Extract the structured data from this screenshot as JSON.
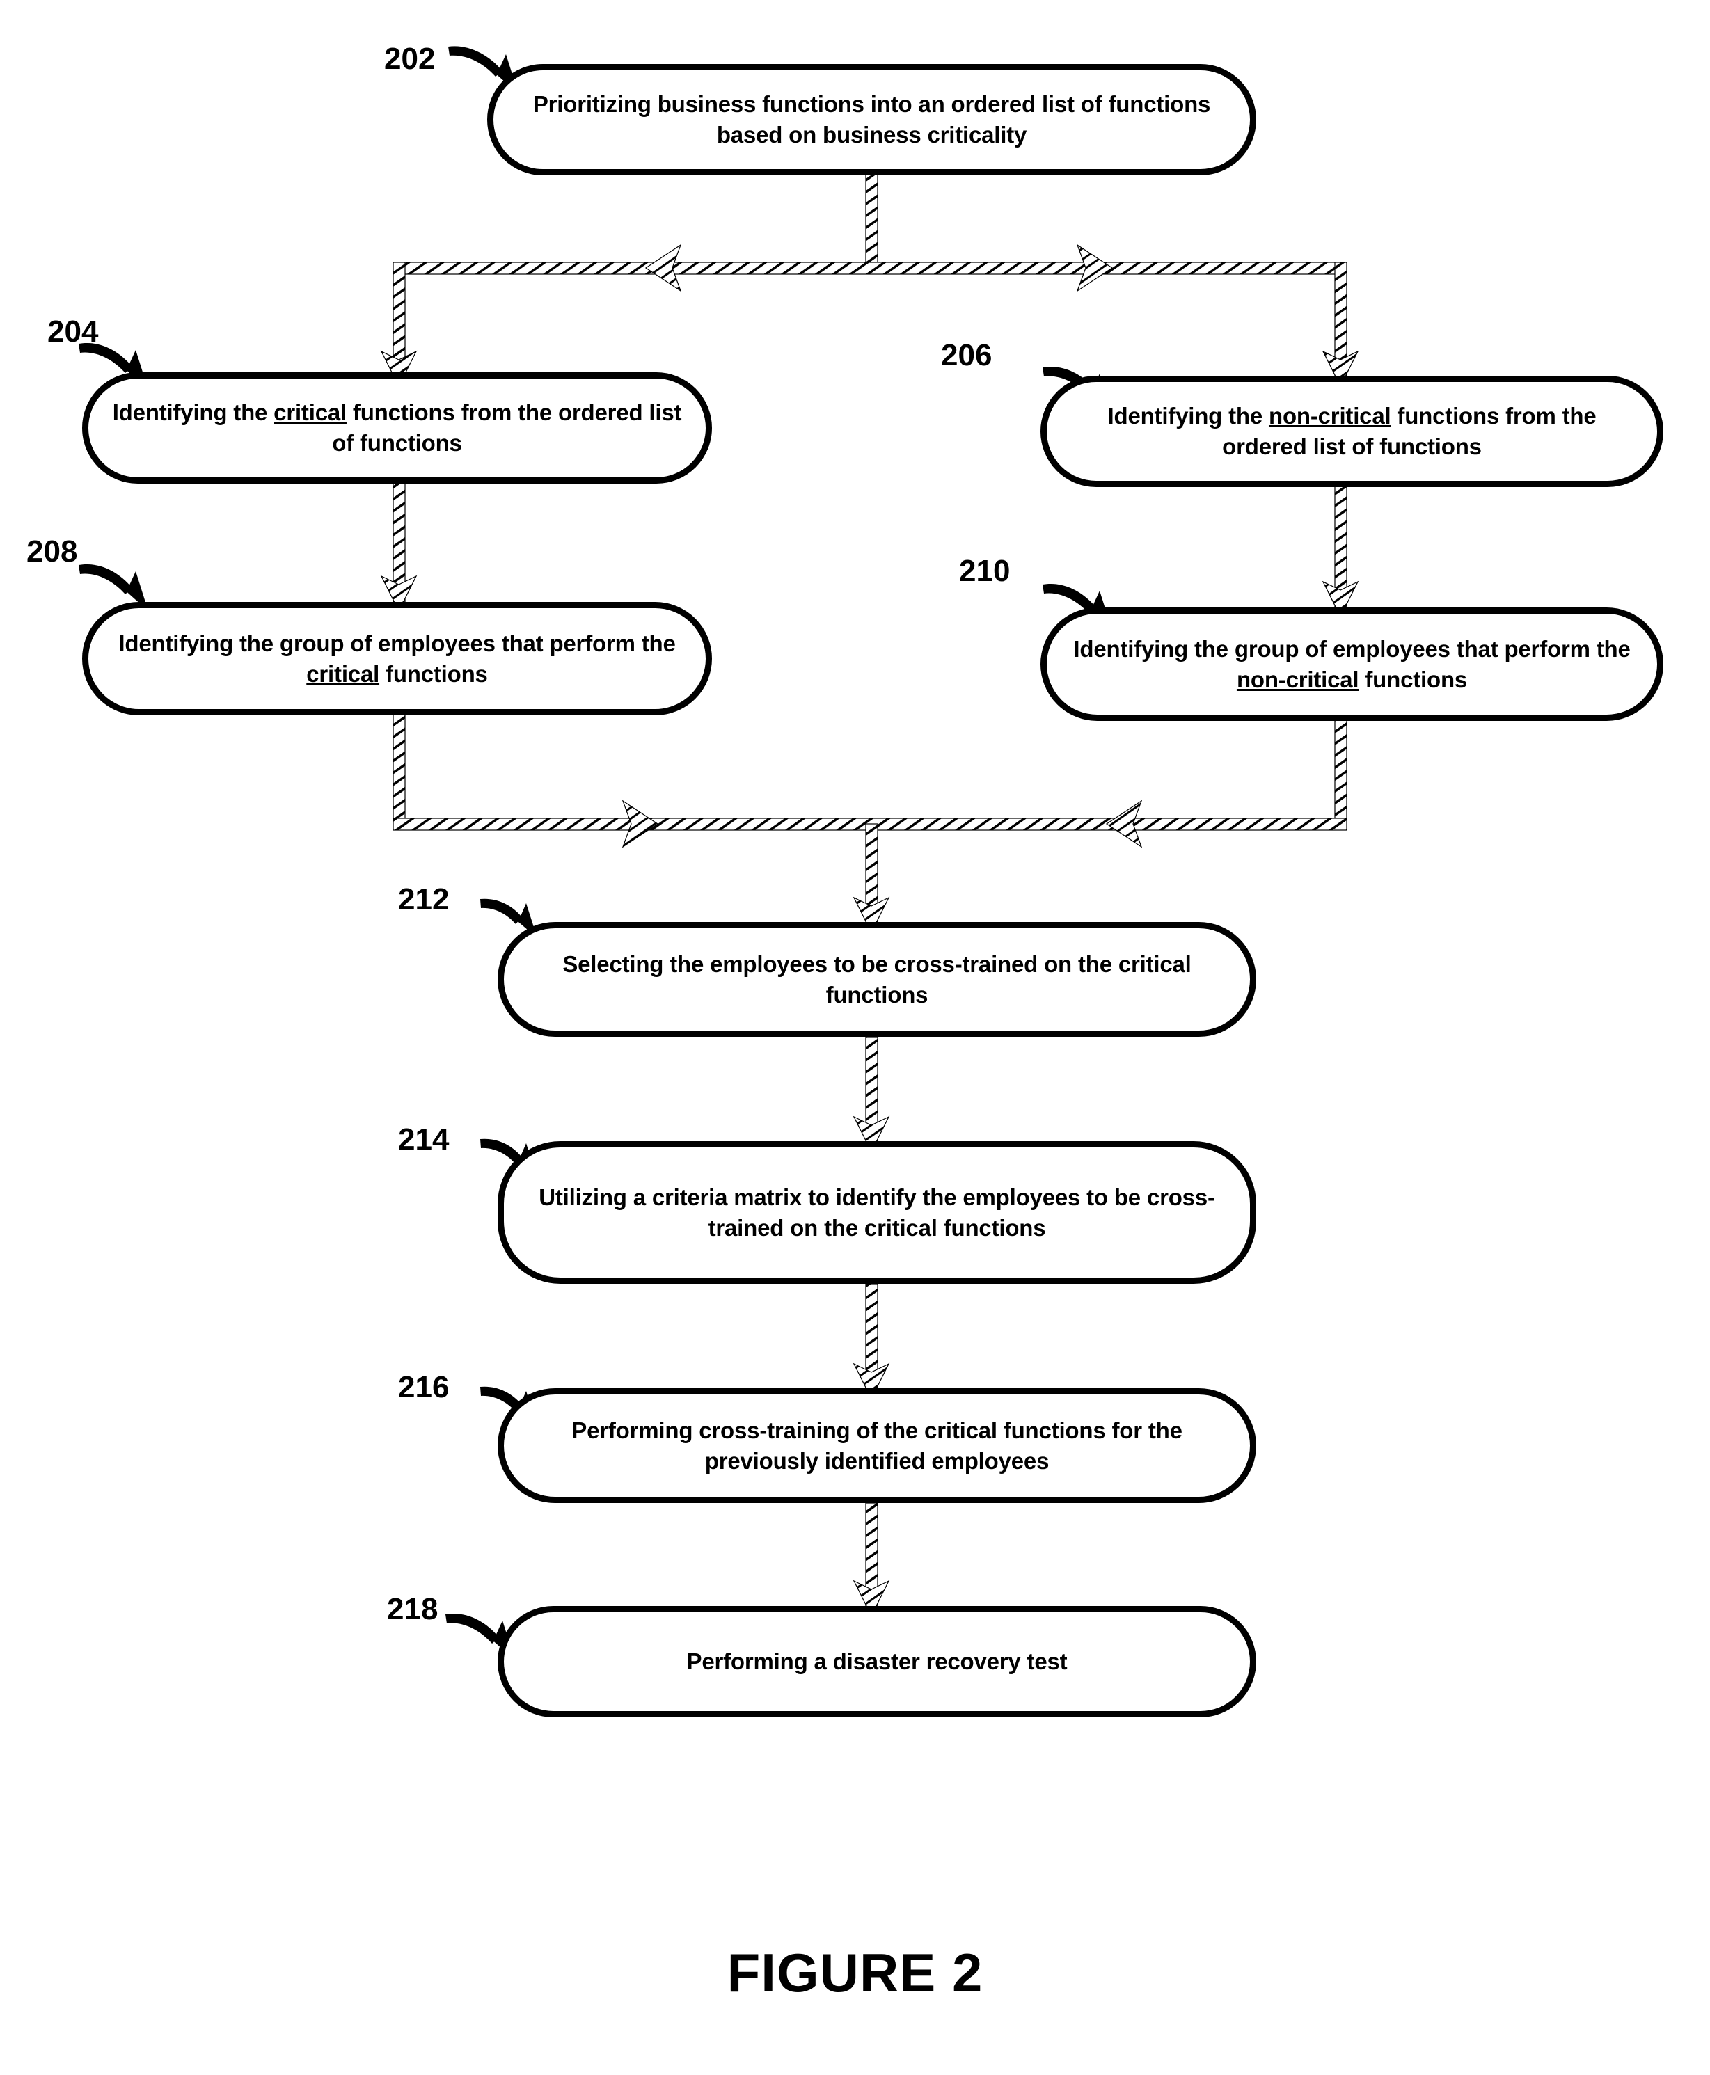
{
  "figure": {
    "caption": "FIGURE 2"
  },
  "nodes": [
    {
      "ref": "202",
      "text_html": "Prioritizing business functions into an ordered list of functions based on business criticality",
      "line1": "Prioritizing business functions into an ordered list",
      "line2": "of functions based on business criticality"
    },
    {
      "ref": "204",
      "text_html": "Identifying the <u>critical</u> functions from the ordered list of functions",
      "line1": "Identifying the critical functions from the",
      "line2": "ordered list of functions",
      "underlined": "critical"
    },
    {
      "ref": "206",
      "text_html": "Identifying the <u>non-critical</u> functions from the ordered list of functions",
      "line1": "Identifying the non-critical functions from",
      "line2": "the ordered list of functions",
      "underlined": "non-critical"
    },
    {
      "ref": "208",
      "text_html": "Identifying the group of employees that perform the <u>critical</u> functions",
      "line1": "Identifying the group of employees",
      "line2": "that perform the critical functions",
      "underlined": "critical"
    },
    {
      "ref": "210",
      "text_html": "Identifying the group of employees that perform the <u>non-critical</u> functions",
      "line1": "Identifying the group of employees",
      "line2": "that perform the non-critical functions",
      "underlined": "non-critical"
    },
    {
      "ref": "212",
      "text_html": "Selecting the employees to be cross-trained on the critical functions",
      "line1": "Selecting the employees to be cross-trained on",
      "line2": "the critical functions"
    },
    {
      "ref": "214",
      "text_html": "Utilizing a criteria matrix to identify the employees to be cross-trained on the critical functions",
      "line1": "Utilizing a criteria matrix to identify the",
      "line2": "employees to be cross-trained on the critical",
      "line3": "functions"
    },
    {
      "ref": "216",
      "text_html": "Performing cross-training of the critical functions for the previously identified employees",
      "line1": "Performing cross-training of the critical functions",
      "line2": "for the previously identified employees"
    },
    {
      "ref": "218",
      "text_html": "Performing a disaster recovery test",
      "line1": "Performing a disaster recovery test"
    }
  ],
  "colors": {
    "ink": "#000000",
    "paper": "#ffffff"
  }
}
